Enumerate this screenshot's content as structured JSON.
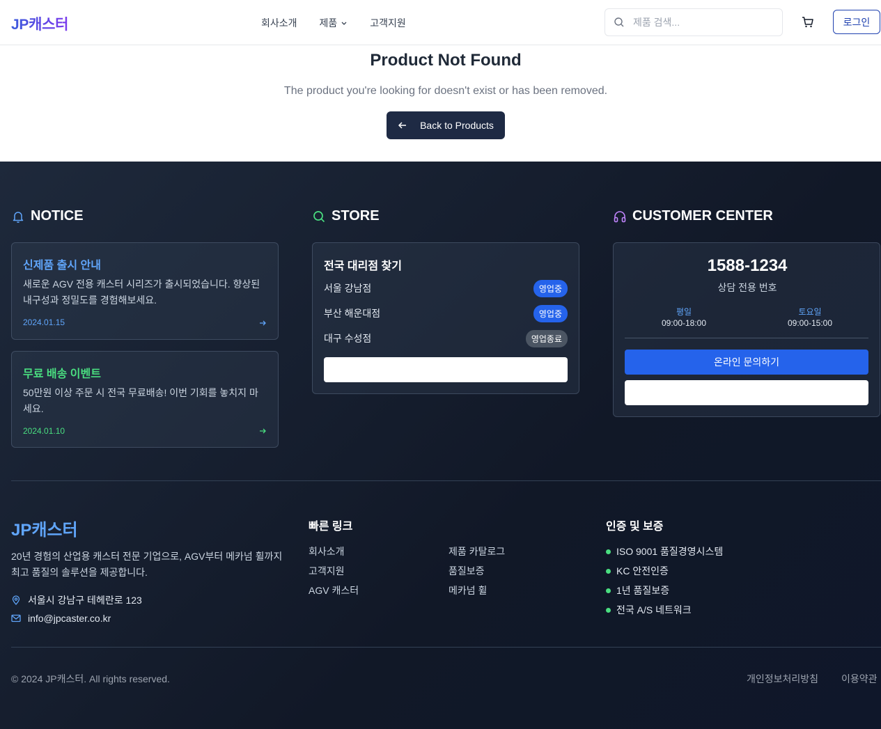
{
  "header": {
    "logo": "JP캐스터",
    "nav": [
      {
        "label": "회사소개"
      },
      {
        "label": "제품"
      },
      {
        "label": "고객지원"
      }
    ],
    "search_placeholder": "제품 검색...",
    "login_label": "로그인"
  },
  "not_found": {
    "title": "Product Not Found",
    "description": "The product you're looking for doesn't exist or has been removed.",
    "back_label": "Back to Products"
  },
  "notice": {
    "title": "NOTICE",
    "items": [
      {
        "title": "신제품 출시 안내",
        "body": "새로운 AGV 전용 캐스터 시리즈가 출시되었습니다. 향상된 내구성과 정밀도를 경험해보세요.",
        "date": "2024.01.15",
        "color": "#60a5fa"
      },
      {
        "title": "무료 배송 이벤트",
        "body": "50만원 이상 주문 시 전국 무료배송! 이번 기회를 놓치지 마세요.",
        "date": "2024.01.10",
        "color": "#4ade80"
      }
    ]
  },
  "store": {
    "title": "STORE",
    "card_title": "전국 대리점 찾기",
    "branches": [
      {
        "name": "서울 강남점",
        "status": "영업중",
        "open": true
      },
      {
        "name": "부산 해운대점",
        "status": "영업중",
        "open": true
      },
      {
        "name": "대구 수성점",
        "status": "영업종료",
        "open": false
      }
    ]
  },
  "customer_center": {
    "title": "CUSTOMER CENTER",
    "phone": "1588-1234",
    "phone_caption": "상담 전용 번호",
    "weekday_label": "평일",
    "weekday_hours": "09:00-18:00",
    "saturday_label": "토요일",
    "saturday_hours": "09:00-15:00",
    "inquiry_label": "온라인 문의하기"
  },
  "footer": {
    "logo": "JP캐스터",
    "description": "20년 경험의 산업용 캐스터 전문 기업으로, AGV부터 메카넘 휠까지 최고 품질의 솔루션을 제공합니다.",
    "address": "서울시 강남구 테헤란로 123",
    "email": "info@jpcaster.co.kr",
    "quick_links_title": "빠른 링크",
    "quick_links": [
      "회사소개",
      "고객지원",
      "AGV 캐스터",
      "제품 카탈로그",
      "품질보증",
      "메카넘 휠"
    ],
    "cert_title": "인증 및 보증",
    "certs": [
      "ISO 9001 품질경영시스템",
      "KC 안전인증",
      "1년 품질보증",
      "전국 A/S 네트워크"
    ],
    "copyright": "© 2024 JP캐스터. All rights reserved.",
    "privacy": "개인정보처리방침",
    "terms": "이용약관"
  }
}
